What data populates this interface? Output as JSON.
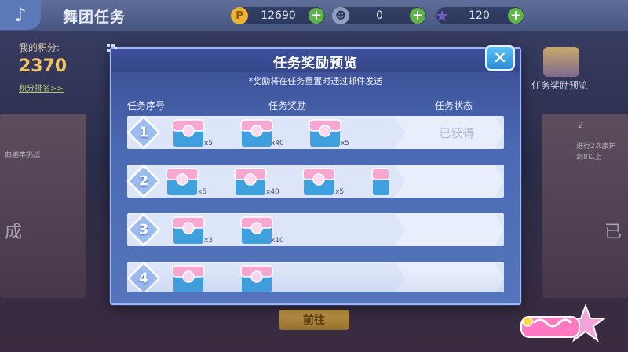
{
  "topbar": {
    "title": "舞团任务",
    "currencies": [
      {
        "icon": "gold-coin-icon",
        "value": "12690",
        "color": "#e9b338"
      },
      {
        "icon": "dance-coin-icon",
        "value": "0",
        "color": "#8fa0bf"
      },
      {
        "icon": "star-icon",
        "value": "120",
        "color": "#7b5cc9"
      }
    ]
  },
  "sidebar": {
    "score_label": "我的积分:",
    "score_value": "2370",
    "rank_link": "积分排名>>"
  },
  "background": {
    "left_card_text": "曲副本挑战",
    "left_card_big": "成",
    "right_card_num": "2",
    "right_card_text": "进行2次康护\n到8以上",
    "right_card_big": "已",
    "reward_preview_label": "任务奖励预览",
    "goto_button": "前往"
  },
  "modal": {
    "title": "任务奖励预览",
    "note": "*奖励将在任务重置时通过邮件发送",
    "headers": {
      "index": "任务序号",
      "reward": "任务奖励",
      "status": "任务状态"
    },
    "close_label": "✕",
    "rows": [
      {
        "num": "1",
        "rewards": [
          "x5",
          "x40",
          "x5"
        ],
        "status": "已获得"
      },
      {
        "num": "2",
        "rewards": [
          "x5",
          "x40",
          "x5",
          ""
        ],
        "status": ""
      },
      {
        "num": "3",
        "rewards": [
          "x3",
          "x10"
        ],
        "status": ""
      },
      {
        "num": "4",
        "rewards": [
          "",
          ""
        ],
        "status": ""
      }
    ]
  },
  "colors": {
    "accent": "#4a6ab4",
    "row_bg": "#dde5f8",
    "badge": "#8fb0ea",
    "chest_pink": "#f6a7d2",
    "chest_blue": "#3ea0df"
  }
}
